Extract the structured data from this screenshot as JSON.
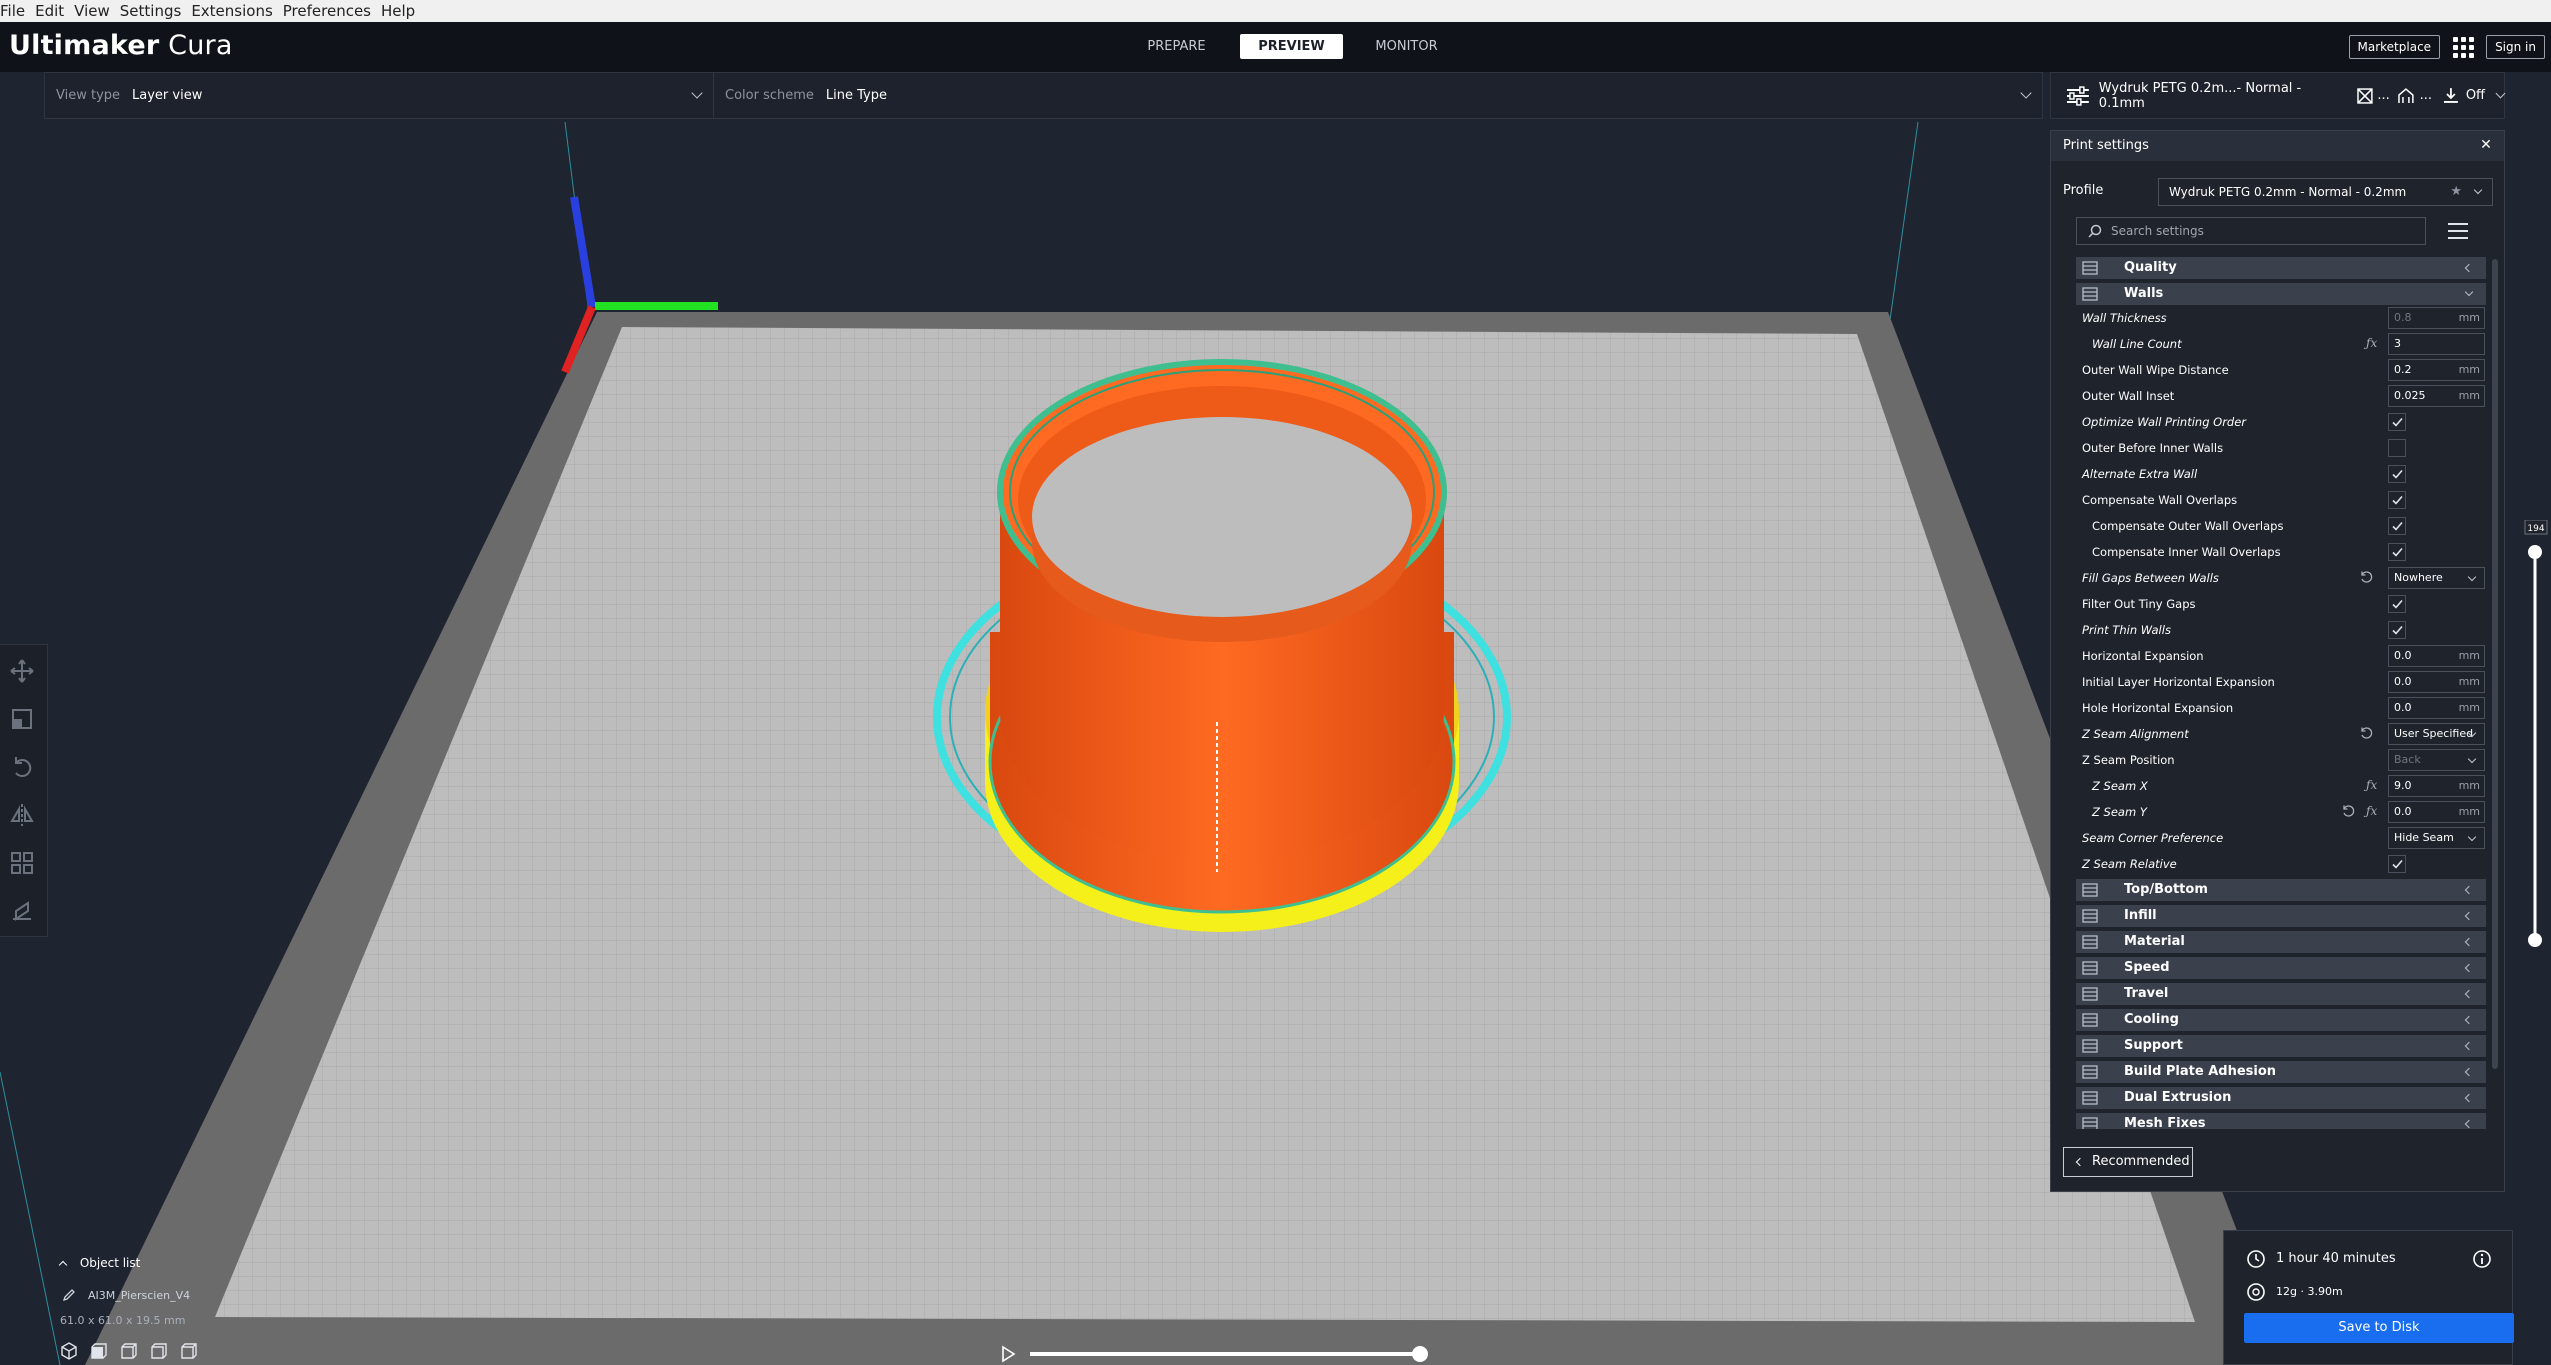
{
  "menubar": {
    "items": [
      "File",
      "Edit",
      "View",
      "Settings",
      "Extensions",
      "Preferences",
      "Help"
    ]
  },
  "header": {
    "brand_bold": "Ultimaker",
    "brand_light": "Cura",
    "stages": [
      {
        "label": "PREPARE",
        "active": false
      },
      {
        "label": "PREVIEW",
        "active": true
      },
      {
        "label": "MONITOR",
        "active": false
      }
    ],
    "marketplace_label": "Marketplace",
    "signin_label": "Sign in"
  },
  "viewbar": {
    "viewtype_label": "View type",
    "viewtype_value": "Layer view",
    "colorscheme_label": "Color scheme",
    "colorscheme_value": "Line Type"
  },
  "setup_bar": {
    "profile_summary": "Wydruk PETG 0.2m...- Normal - 0.1mm",
    "ellipsis_1": "...",
    "ellipsis_2": "...",
    "adhesion_value": "Off"
  },
  "layer_slider": {
    "max_label": "194"
  },
  "panel": {
    "title": "Print settings",
    "profile_label": "Profile",
    "profile_value": "Wydruk PETG 0.2mm - Normal - 0.2mm",
    "search_placeholder": "Search settings",
    "recommended_label": "Recommended",
    "categories_top": [
      {
        "label": "Quality",
        "open": false
      },
      {
        "label": "Walls",
        "open": true
      }
    ],
    "walls_settings": [
      {
        "label": "Wall Thickness",
        "italic": true,
        "indent": 0,
        "type": "number",
        "value": "0.8",
        "unit": "mm",
        "disabled": true
      },
      {
        "label": "Wall Line Count",
        "italic": true,
        "indent": 1,
        "type": "number",
        "value": "3",
        "unit": "",
        "fx": true
      },
      {
        "label": "Outer Wall Wipe Distance",
        "italic": false,
        "indent": 0,
        "type": "number",
        "value": "0.2",
        "unit": "mm"
      },
      {
        "label": "Outer Wall Inset",
        "italic": false,
        "indent": 0,
        "type": "number",
        "value": "0.025",
        "unit": "mm"
      },
      {
        "label": "Optimize Wall Printing Order",
        "italic": true,
        "indent": 0,
        "type": "checkbox",
        "checked": true
      },
      {
        "label": "Outer Before Inner Walls",
        "italic": false,
        "indent": 0,
        "type": "checkbox",
        "checked": false
      },
      {
        "label": "Alternate Extra Wall",
        "italic": true,
        "indent": 0,
        "type": "checkbox",
        "checked": true
      },
      {
        "label": "Compensate Wall Overlaps",
        "italic": false,
        "indent": 0,
        "type": "checkbox",
        "checked": true
      },
      {
        "label": "Compensate Outer Wall Overlaps",
        "italic": false,
        "indent": 1,
        "type": "checkbox",
        "checked": true
      },
      {
        "label": "Compensate Inner Wall Overlaps",
        "italic": false,
        "indent": 1,
        "type": "checkbox",
        "checked": true
      },
      {
        "label": "Fill Gaps Between Walls",
        "italic": true,
        "indent": 0,
        "type": "select",
        "value": "Nowhere",
        "reset": true
      },
      {
        "label": "Filter Out Tiny Gaps",
        "italic": false,
        "indent": 0,
        "type": "checkbox",
        "checked": true
      },
      {
        "label": "Print Thin Walls",
        "italic": true,
        "indent": 0,
        "type": "checkbox",
        "checked": true
      },
      {
        "label": "Horizontal Expansion",
        "italic": false,
        "indent": 0,
        "type": "number",
        "value": "0.0",
        "unit": "mm"
      },
      {
        "label": "Initial Layer Horizontal Expansion",
        "italic": false,
        "indent": 0,
        "type": "number",
        "value": "0.0",
        "unit": "mm"
      },
      {
        "label": "Hole Horizontal Expansion",
        "italic": false,
        "indent": 0,
        "type": "number",
        "value": "0.0",
        "unit": "mm"
      },
      {
        "label": "Z Seam Alignment",
        "italic": true,
        "indent": 0,
        "type": "select",
        "value": "User Specified",
        "reset": true
      },
      {
        "label": "Z Seam Position",
        "italic": false,
        "indent": 0,
        "type": "select",
        "value": "Back",
        "disabled": true
      },
      {
        "label": "Z Seam X",
        "italic": true,
        "indent": 1,
        "type": "number",
        "value": "9.0",
        "unit": "mm",
        "fx": true
      },
      {
        "label": "Z Seam Y",
        "italic": true,
        "indent": 1,
        "type": "number",
        "value": "0.0",
        "unit": "mm",
        "fx": true,
        "reset": true
      },
      {
        "label": "Seam Corner Preference",
        "italic": true,
        "indent": 0,
        "type": "select",
        "value": "Hide Seam"
      },
      {
        "label": "Z Seam Relative",
        "italic": true,
        "indent": 0,
        "type": "checkbox",
        "checked": true
      }
    ],
    "categories_bottom": [
      {
        "label": "Top/Bottom",
        "icon": "top-bottom-icon"
      },
      {
        "label": "Infill",
        "icon": "infill-icon"
      },
      {
        "label": "Material",
        "icon": "material-icon"
      },
      {
        "label": "Speed",
        "icon": "speed-icon"
      },
      {
        "label": "Travel",
        "icon": "travel-icon"
      },
      {
        "label": "Cooling",
        "icon": "cooling-icon"
      },
      {
        "label": "Support",
        "icon": "support-icon"
      },
      {
        "label": "Build Plate Adhesion",
        "icon": "build-plate-adhesion-icon"
      },
      {
        "label": "Dual Extrusion",
        "icon": "dual-extrusion-icon"
      },
      {
        "label": "Mesh Fixes",
        "icon": "mesh-fixes-icon"
      }
    ]
  },
  "object": {
    "list_label": "Object list",
    "name": "AI3M_Pierscien_V4",
    "dimensions": "61.0 x 61.0 x 19.5 mm"
  },
  "job": {
    "time": "1 hour 40 minutes",
    "material": "12g · 3.90m",
    "save_label": "Save to Disk"
  },
  "colors": {
    "accent": "#196ef0",
    "wall_outer": "#ff5f1f",
    "wall_inner": "#3fbf8f",
    "skirt": "#3fe0e0",
    "support_bottom": "#f5f01a",
    "plate": "#b9b9b9",
    "background": "#1f2530"
  }
}
